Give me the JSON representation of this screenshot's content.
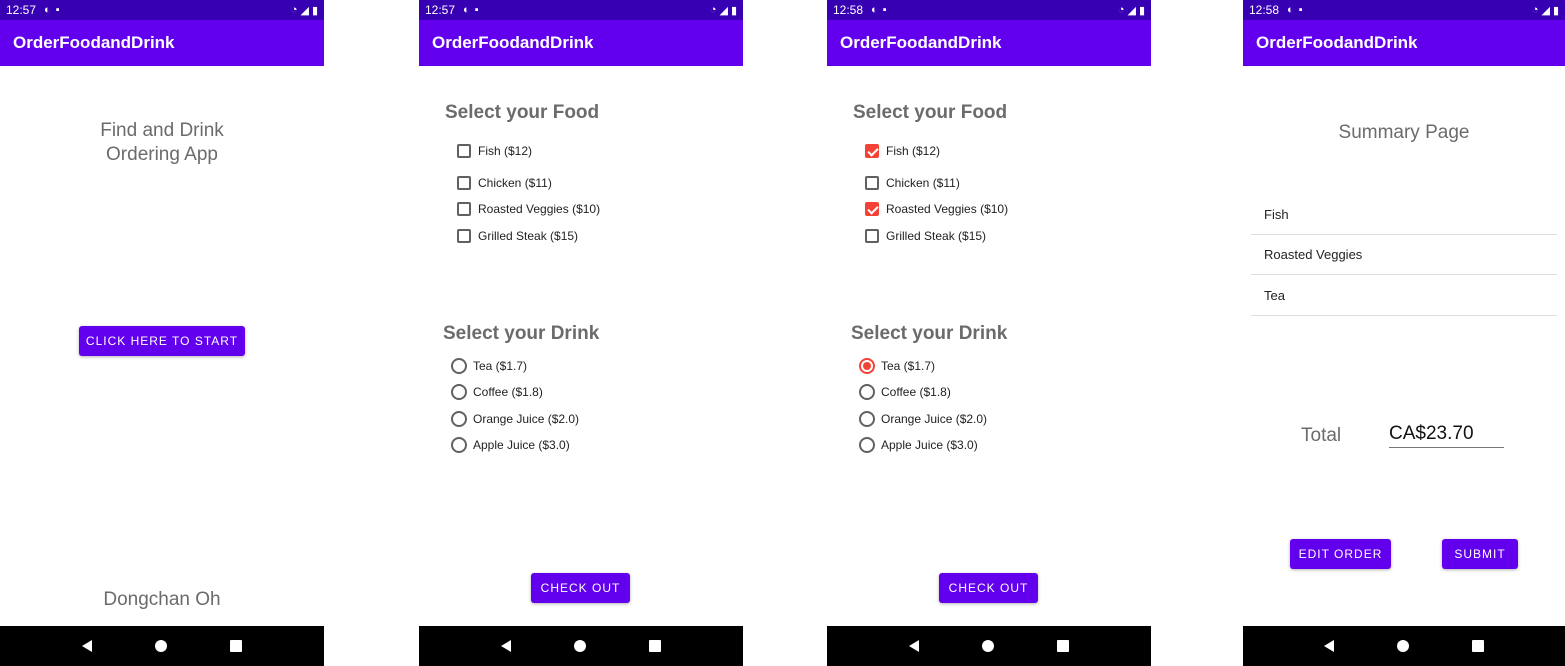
{
  "app_title": "OrderFoodandDrink",
  "colors": {
    "appbar": "#6200ee",
    "statusbar": "#3700b3",
    "accent": "#f44336",
    "button": "#6200ee"
  },
  "nav_icons": [
    "back-icon",
    "home-icon",
    "recents-icon"
  ],
  "screens": [
    {
      "status_time": "12:57",
      "heading": "Find and Drink Ordering App",
      "start_button": "CLICK HERE TO START",
      "author": "Dongchan Oh"
    },
    {
      "status_time": "12:57",
      "food_title": "Select your Food",
      "food_options": [
        {
          "label": "Fish ($12)",
          "checked": false
        },
        {
          "label": "Chicken ($11)",
          "checked": false
        },
        {
          "label": "Roasted Veggies ($10)",
          "checked": false
        },
        {
          "label": "Grilled Steak ($15)",
          "checked": false
        }
      ],
      "drink_title": "Select your Drink",
      "drink_options": [
        {
          "label": "Tea ($1.7)",
          "selected": false
        },
        {
          "label": "Coffee ($1.8)",
          "selected": false
        },
        {
          "label": "Orange Juice ($2.0)",
          "selected": false
        },
        {
          "label": "Apple Juice ($3.0)",
          "selected": false
        }
      ],
      "checkout_button": "CHECK OUT"
    },
    {
      "status_time": "12:58",
      "food_title": "Select your Food",
      "food_options": [
        {
          "label": "Fish ($12)",
          "checked": true
        },
        {
          "label": "Chicken ($11)",
          "checked": false
        },
        {
          "label": "Roasted Veggies ($10)",
          "checked": true
        },
        {
          "label": "Grilled Steak ($15)",
          "checked": false
        }
      ],
      "drink_title": "Select your Drink",
      "drink_options": [
        {
          "label": "Tea ($1.7)",
          "selected": true
        },
        {
          "label": "Coffee ($1.8)",
          "selected": false
        },
        {
          "label": "Orange Juice ($2.0)",
          "selected": false
        },
        {
          "label": "Apple Juice ($3.0)",
          "selected": false
        }
      ],
      "checkout_button": "CHECK OUT"
    },
    {
      "status_time": "12:58",
      "heading": "Summary Page",
      "items": [
        "Fish",
        "Roasted Veggies",
        "Tea"
      ],
      "total_label": "Total",
      "total_value": "CA$23.70",
      "edit_button": "EDIT ORDER",
      "submit_button": "SUBMIT"
    }
  ]
}
